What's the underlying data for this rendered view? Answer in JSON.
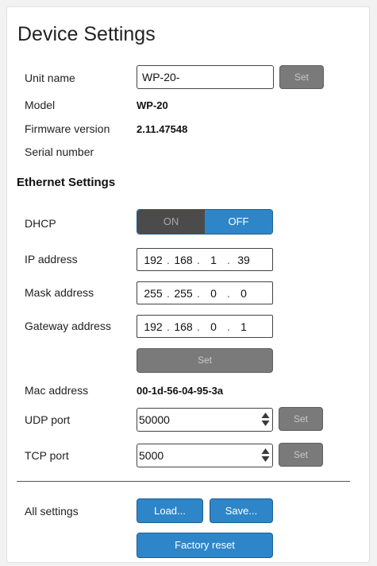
{
  "page": {
    "title": "Device Settings"
  },
  "device": {
    "unit_name_label": "Unit name",
    "unit_name_value": "WP-20-",
    "set_label": "Set",
    "model_label": "Model",
    "model_value": "WP-20",
    "firmware_label": "Firmware version",
    "firmware_value": "2.11.47548",
    "serial_label": "Serial number"
  },
  "ethernet": {
    "section_title": "Ethernet Settings",
    "dhcp_label": "DHCP",
    "dhcp_on": "ON",
    "dhcp_off": "OFF",
    "dhcp_state": "OFF",
    "ip_label": "IP address",
    "ip": [
      "192",
      "168",
      "1",
      "39"
    ],
    "mask_label": "Mask address",
    "mask": [
      "255",
      "255",
      "0",
      "0"
    ],
    "gateway_label": "Gateway address",
    "gateway": [
      "192",
      "168",
      "0",
      "1"
    ],
    "set_label": "Set",
    "mac_label": "Mac address",
    "mac_value": "00-1d-56-04-95-3a",
    "udp_label": "UDP port",
    "udp_value": "50000",
    "tcp_label": "TCP port",
    "tcp_value": "5000"
  },
  "all_settings": {
    "label": "All settings",
    "load_label": "Load...",
    "save_label": "Save...",
    "factory_reset_label": "Factory reset"
  },
  "colors": {
    "accent_blue": "#2e86c9",
    "disabled_gray": "#7a7a7a",
    "toggle_dark": "#4b4b4b"
  },
  "icons": {
    "spinner": "up-down-arrows-icon"
  }
}
